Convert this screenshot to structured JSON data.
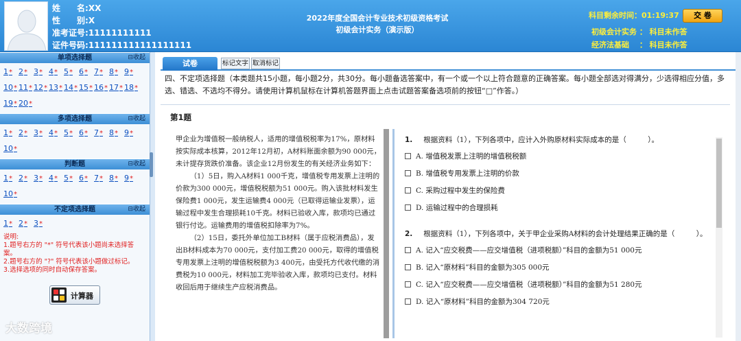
{
  "candidate": {
    "name_label": "姓　　名:",
    "name_value": "XX",
    "gender_label": "性　　别:",
    "gender_value": "X",
    "ticket_label": "准考证号:",
    "ticket_value": "11111111111",
    "id_label": "证件号码:",
    "id_value": "111111111111111111"
  },
  "exam": {
    "title_line1": "2022年度全国会计专业技术初级资格考试",
    "title_line2": "初级会计实务（演示版）"
  },
  "timer": {
    "label": "科目剩余时间：",
    "value": "01:19:37"
  },
  "submit_label": "交 卷",
  "subject_status": [
    {
      "label": "初级会计实务 ： 科目未作答"
    },
    {
      "label": "经济法基础　 ： 科目未作答"
    }
  ],
  "sidebar": {
    "collapse_label": "⊟收起",
    "sections": [
      {
        "title": "单项选择题",
        "questions": [
          "1",
          "2",
          "3",
          "4",
          "5",
          "6",
          "7",
          "8",
          "9",
          "10",
          "11",
          "12",
          "13",
          "14",
          "15",
          "16",
          "17",
          "18",
          "19",
          "20"
        ]
      },
      {
        "title": "多项选择题",
        "questions": [
          "1",
          "2",
          "3",
          "4",
          "5",
          "6",
          "7",
          "8",
          "9",
          "10"
        ]
      },
      {
        "title": "判断题",
        "questions": [
          "1",
          "2",
          "3",
          "4",
          "5",
          "6",
          "7",
          "8",
          "9",
          "10"
        ]
      },
      {
        "title": "不定项选择题",
        "questions": [
          "1",
          "2",
          "3"
        ]
      }
    ],
    "mark_symbol": "*",
    "notes": [
      "说明:",
      "1.题号右方的 \"*\" 符号代表该小题尚未选择答案。",
      "2.题号右方的 \"?\" 符号代表该小题做过标记。",
      "3.选择选项的同时自动保存答案。"
    ],
    "calculator_label": "计算器"
  },
  "main": {
    "tab_label": "试卷",
    "mark_text_label": "标记文字",
    "unmark_label": "取消标记",
    "instructions": "四、不定项选择题（本类题共15小题，每小题2分，共30分。每小题备选答案中，有一个或一个以上符合题意的正确答案。每小题全部选对得满分，少选得相应分值，多选、错选、不选均不得分。请使用计算机鼠标在计算机答题界面上点击试题答案备选项前的按钮“□”作答。）",
    "question_title": "第1题",
    "material": [
      "甲企业为增值税一般纳税人，适用的增值税税率为17%，原材料按实际成本核算，2012年12月初，A材料账面余额为90 000元，未计提存货跌价准备。该企业12月份发生的有关经济业务如下：",
      "（1）5日，购入A材料1 000千克，增值税专用发票上注明的价款为300 000元，增值税税额为51 000元。购入该批材料发生保险费1 000元，发生运输费4 000元（已取得运输业发票），运输过程中发生合理损耗10千克。材料已验收入库，款项均已通过银行付讫。运输费用的增值税扣除率为7%。",
      "（2）15日，委托外单位加工B材料（属于应税消费品），发出B材料成本为70 000元，支付加工费20 000元，取得的增值税专用发票上注明的增值税税额为3 400元，由受托方代收代缴的消费税为10 000元，材料加工完毕验收入库，款项均已支付。材料收回后用于继续生产应税消费品。"
    ],
    "subquestions": [
      {
        "num": "1.",
        "stem": "根据资料（1），下列各项中，应计入外购原材料实际成本的是（　　　）。",
        "options": [
          "A. 增值税发票上注明的增值税税额",
          "B. 增值税专用发票上注明的价款",
          "C. 采购过程中发生的保险费",
          "D. 运输过程中的合理损耗"
        ]
      },
      {
        "num": "2.",
        "stem": "根据资料（1），下列各项中，关于甲企业采购A材料的会计处理结果正确的是（　　　）。",
        "options": [
          "A. 记入“应交税费——应交增值税（进项税额）”科目的金额为51 000元",
          "B. 记入“原材料”科目的金额为305 000元",
          "C. 记入“应交税费——应交增值税（进项税额）”科目的金额为51 280元",
          "D. 记入“原材料”科目的金额为304 720元"
        ]
      }
    ]
  },
  "watermark": "大数跨境",
  "colors": {
    "header_blue": "#3a98e2",
    "status_yellow": "#ffef3a",
    "mark_red": "#e02020",
    "link_blue": "#0b4fbf"
  }
}
